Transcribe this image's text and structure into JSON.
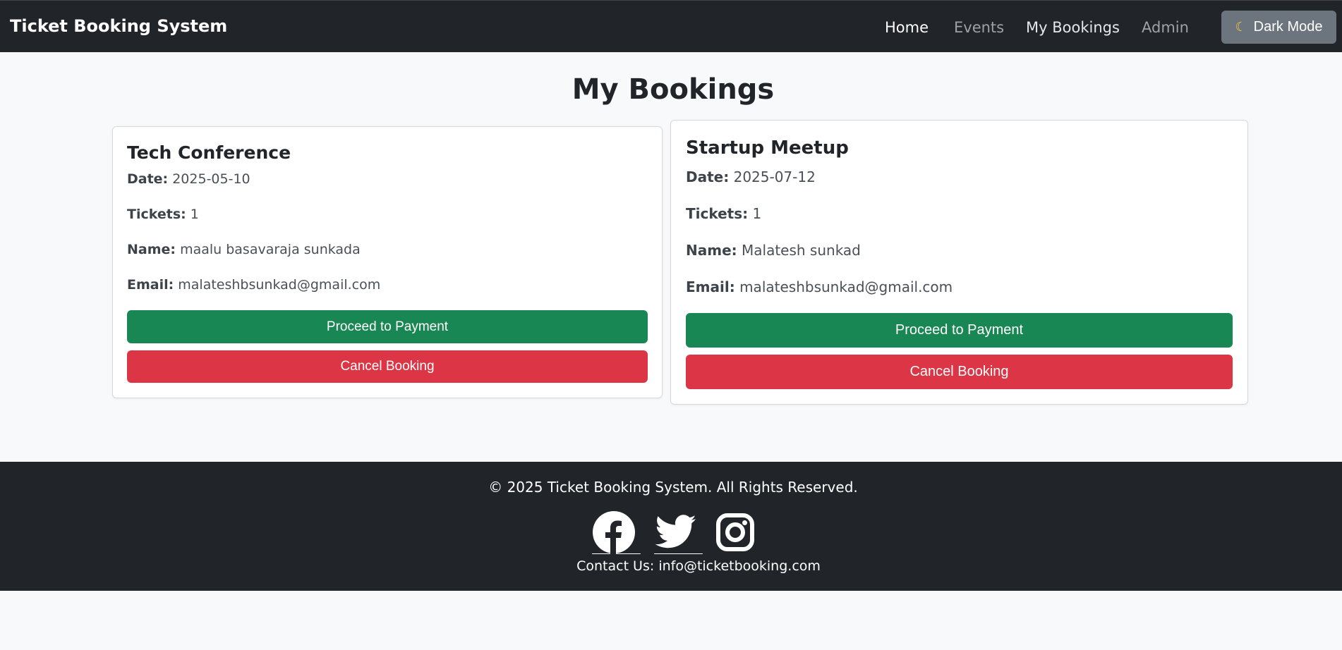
{
  "navbar": {
    "brand": "Ticket Booking System",
    "links": [
      {
        "label": "Home"
      },
      {
        "label": "Events"
      },
      {
        "label": "My Bookings"
      },
      {
        "label": "Admin"
      }
    ],
    "dark_mode": {
      "icon": "moon-icon",
      "label": "Dark Mode"
    }
  },
  "page": {
    "title": "My Bookings"
  },
  "bookings": [
    {
      "event": "Tech Conference",
      "date_label": "Date:",
      "date": "2025-05-10",
      "tickets_label": "Tickets:",
      "tickets": "1",
      "name_label": "Name:",
      "name": "maalu basavaraja sunkada",
      "email_label": "Email:",
      "email": "malateshbsunkad@gmail.com",
      "pay_label": "Proceed to Payment",
      "cancel_label": "Cancel Booking"
    },
    {
      "event": "Startup Meetup",
      "date_label": "Date:",
      "date": "2025-07-12",
      "tickets_label": "Tickets:",
      "tickets": "1",
      "name_label": "Name:",
      "name": "Malatesh sunkad",
      "email_label": "Email:",
      "email": "malateshbsunkad@gmail.com",
      "pay_label": "Proceed to Payment",
      "cancel_label": "Cancel Booking"
    }
  ],
  "footer": {
    "copyright": "© 2025 Ticket Booking System. All Rights Reserved.",
    "social": [
      "facebook-icon",
      "twitter-icon",
      "instagram-icon"
    ],
    "contact_prefix": "Contact Us:",
    "contact_email": "info@ticketbooking.com"
  },
  "colors": {
    "navbar_bg": "#212529",
    "page_bg": "#f8f9fa",
    "success": "#198754",
    "danger": "#dc3545",
    "secondary": "#6c757d"
  }
}
